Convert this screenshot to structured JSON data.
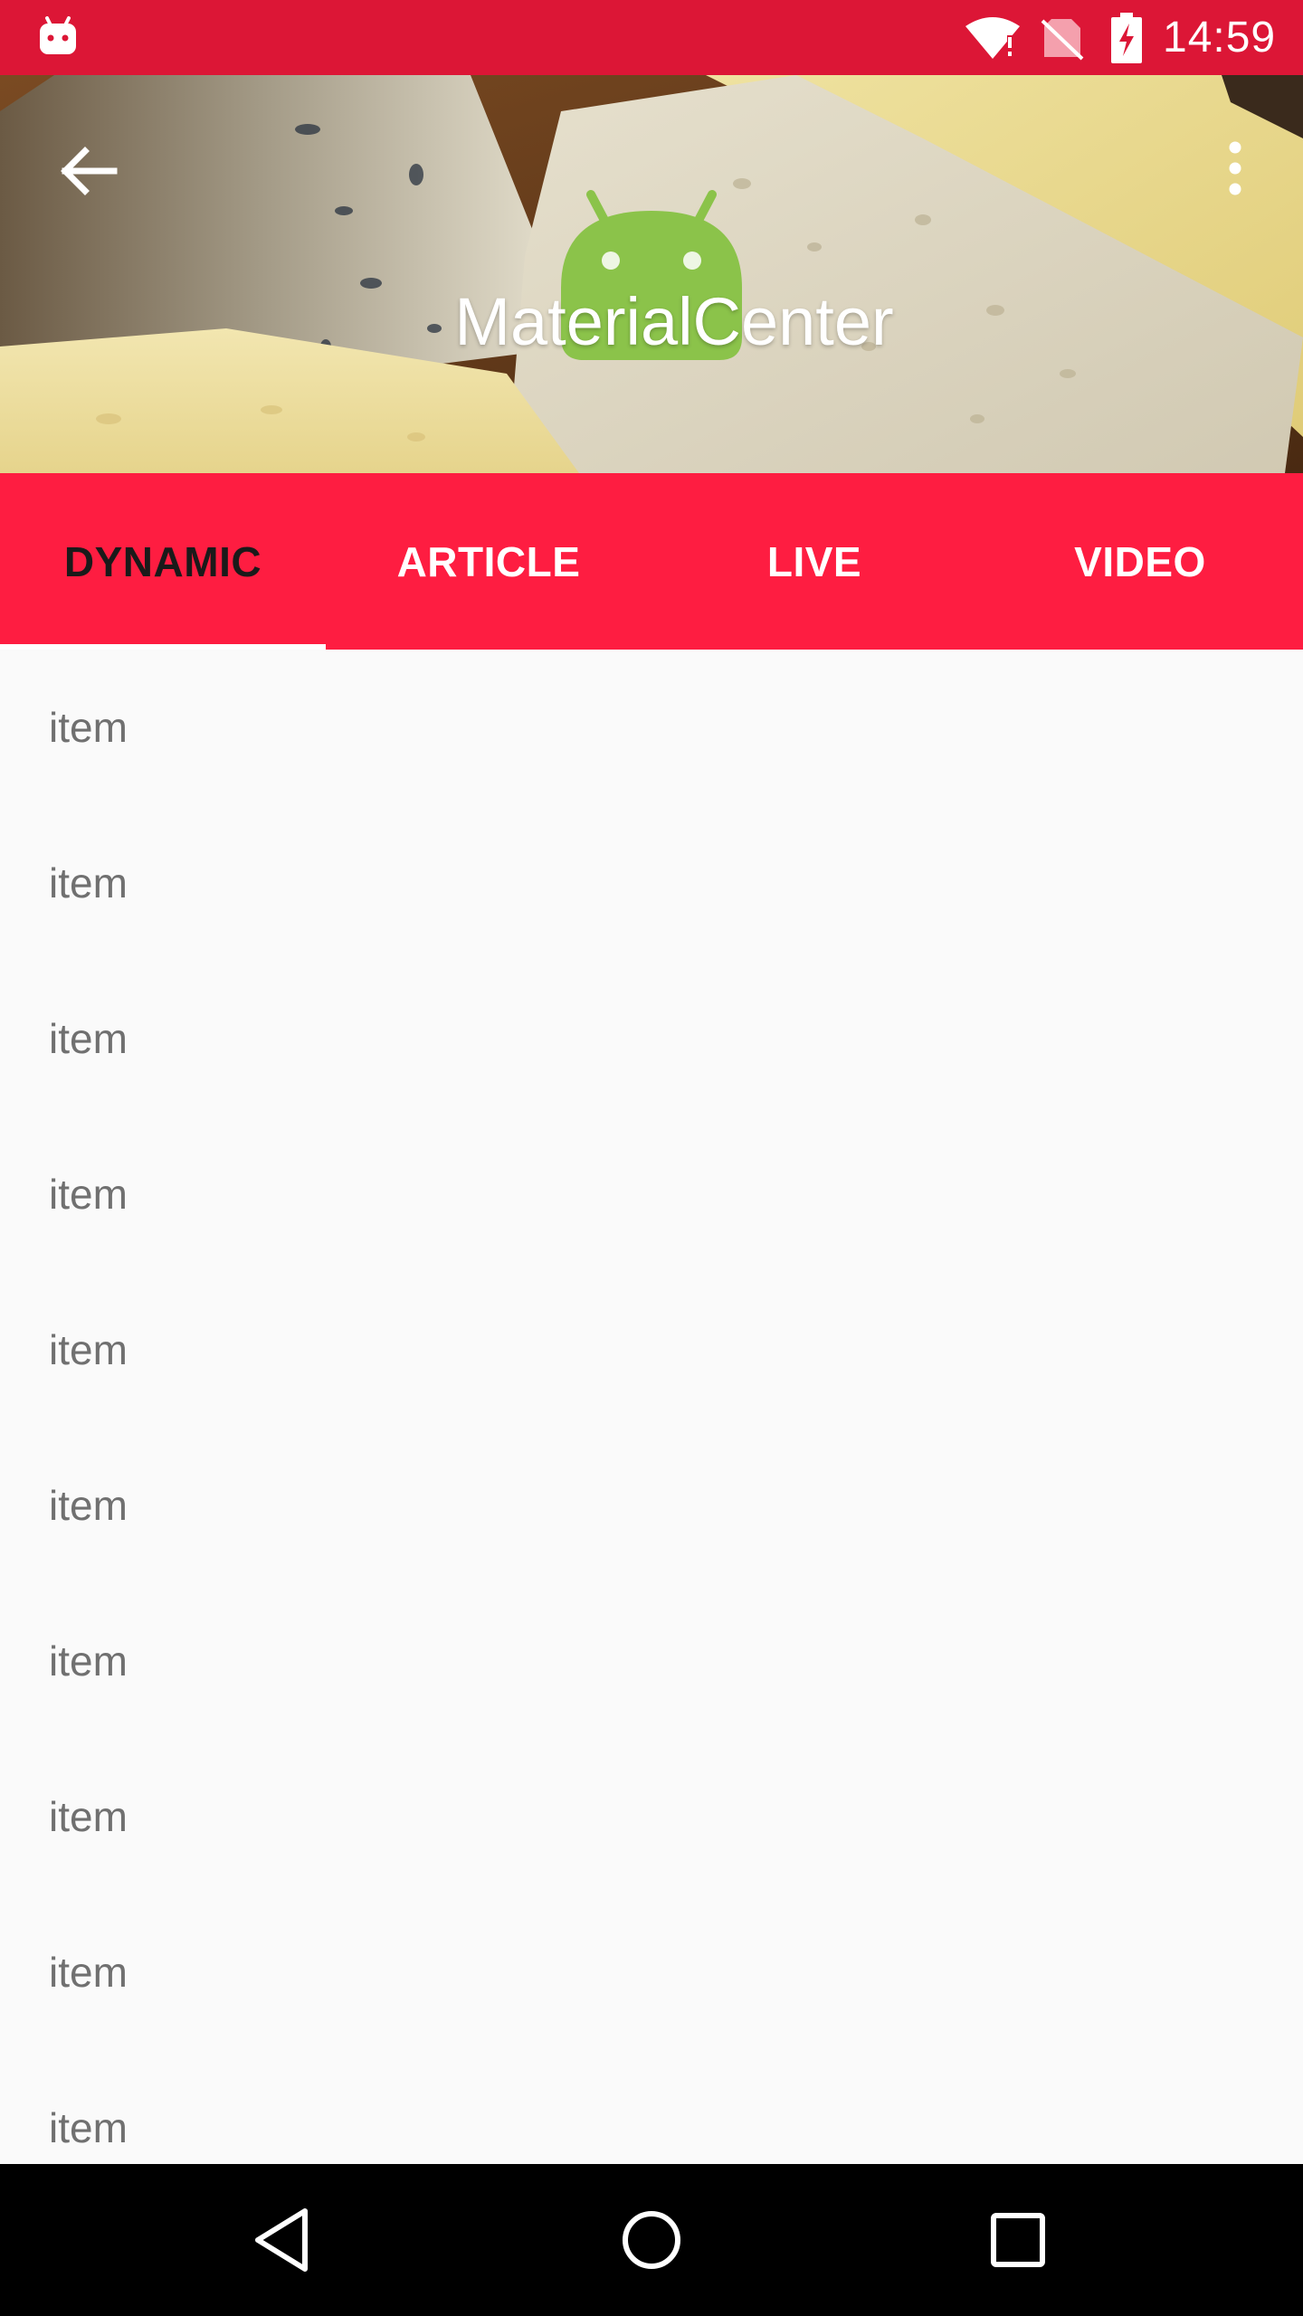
{
  "status_bar": {
    "time": "14:59",
    "icons": [
      "android-notification-icon",
      "wifi-icon",
      "no-sim-icon",
      "battery-charging-icon"
    ]
  },
  "toolbar": {
    "title": "MaterialCenter",
    "back_icon": "arrow-back-icon",
    "menu_icon": "more-vert-icon"
  },
  "tabs": [
    {
      "label": "DYNAMIC",
      "selected": true
    },
    {
      "label": "ARTICLE",
      "selected": false
    },
    {
      "label": "LIVE",
      "selected": false
    },
    {
      "label": "VIDEO",
      "selected": false
    }
  ],
  "list": {
    "items": [
      "item",
      "item",
      "item",
      "item",
      "item",
      "item",
      "item",
      "item",
      "item",
      "item"
    ]
  },
  "nav_bar": {
    "icons": [
      "nav-back-icon",
      "nav-home-icon",
      "nav-recents-icon"
    ]
  },
  "colors": {
    "status_bar": "#dc1636",
    "tab_bar": "#fe1d41",
    "tab_selected_text": "#1a1a1a",
    "tab_text": "#ffffff",
    "list_background": "#fafafa",
    "list_text": "#707070",
    "android_green": "#8bc34a"
  }
}
